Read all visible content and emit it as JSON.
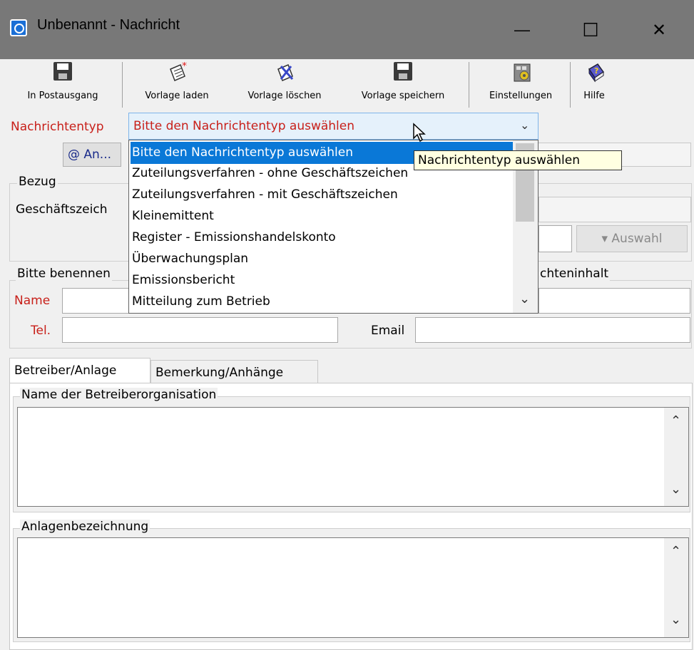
{
  "window": {
    "title": "Unbenannt - Nachricht",
    "minimize": "—",
    "maximize": "☐",
    "close": "✕"
  },
  "toolbar": {
    "items": [
      {
        "label": "In Postausgang",
        "icon": "floppy-disk-icon"
      },
      {
        "label": "Vorlage laden",
        "icon": "document-new-icon"
      },
      {
        "label": "Vorlage löschen",
        "icon": "document-delete-icon"
      },
      {
        "label": "Vorlage speichern",
        "icon": "floppy-disk-icon"
      },
      {
        "label": "Einstellungen",
        "icon": "settings-icon"
      },
      {
        "label": "Hilfe",
        "icon": "help-book-icon"
      }
    ]
  },
  "message_type": {
    "label": "Nachrichtentyp",
    "selected": "Bitte den Nachrichtentyp auswählen",
    "options": [
      "Bitte den Nachrichtentyp auswählen",
      "Zuteilungsverfahren - ohne Geschäftszeichen",
      "Zuteilungsverfahren - mit Geschäftszeichen",
      "Kleinemittent",
      "Register - Emissionshandelskonto",
      "Überwachungsplan",
      "Emissionsbericht",
      "Mitteilung zum Betrieb"
    ],
    "tooltip": "Nachrichtentyp auswählen"
  },
  "recipient": {
    "button_label": "@ An..."
  },
  "bezug": {
    "group_label": "Bezug",
    "geschaeftszeichen_label": "Geschäftszeich",
    "auswahl_label": "▾ Auswahl"
  },
  "contact": {
    "group_label": "Bitte benennen",
    "right_group_label": "chteninhalt",
    "name_label": "Name",
    "tel_label": "Tel.",
    "email_label": "Email"
  },
  "tabs": [
    {
      "label": "Betreiber/Anlage",
      "active": true
    },
    {
      "label": "Bemerkung/Anhänge",
      "active": false
    }
  ],
  "betreiber": {
    "org_label": "Name der Betreiberorganisation",
    "anlage_label": "Anlagenbezeichnung"
  },
  "colors": {
    "label_red": "#c8201a",
    "selection_blue": "#0a78d7",
    "titlebar": "#787878"
  }
}
